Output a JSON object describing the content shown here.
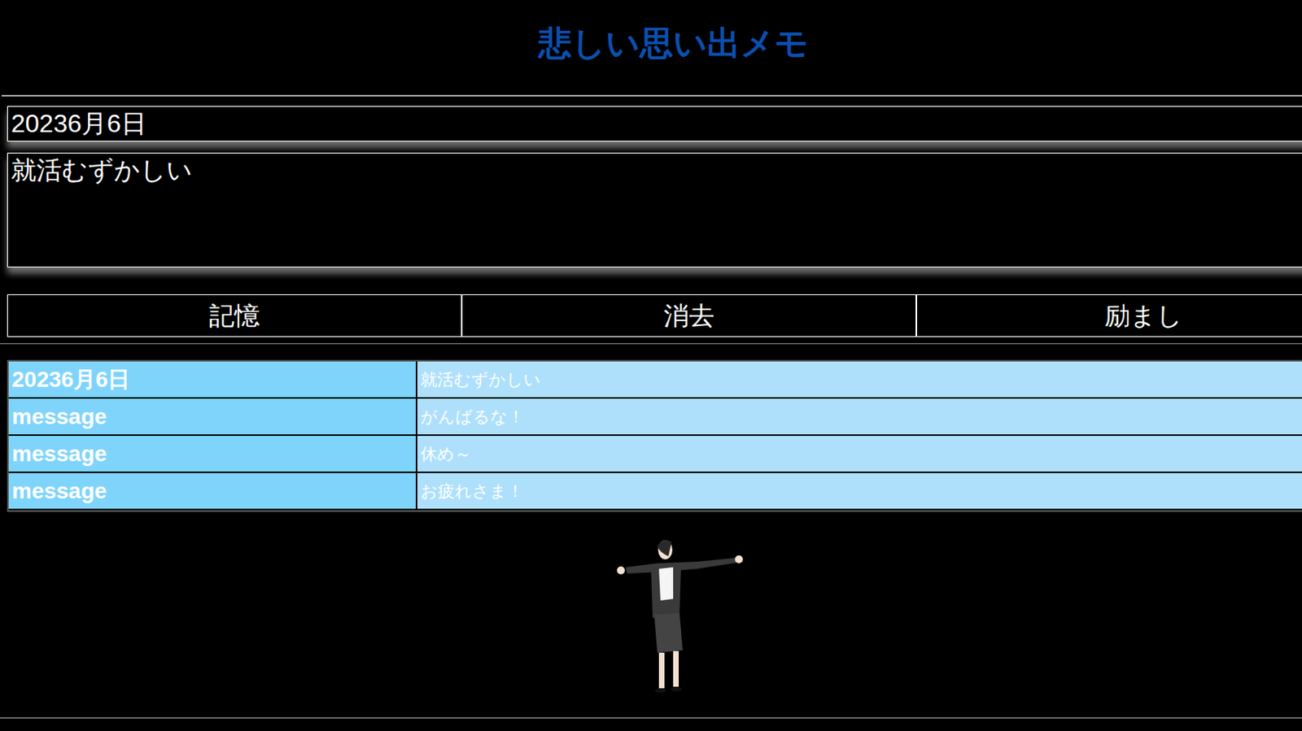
{
  "title": "悲しい思い出メモ",
  "form": {
    "date": "20236月6日",
    "memo": "就活むずかしい"
  },
  "buttons": [
    "記憶",
    "消去",
    "励まし"
  ],
  "entries": [
    {
      "label": "20236月6日",
      "text": "就活むずかしい"
    },
    {
      "label": "message",
      "text": "がんばるな！"
    },
    {
      "label": "message",
      "text": "休め～"
    },
    {
      "label": "message",
      "text": "お疲れさま！"
    }
  ]
}
